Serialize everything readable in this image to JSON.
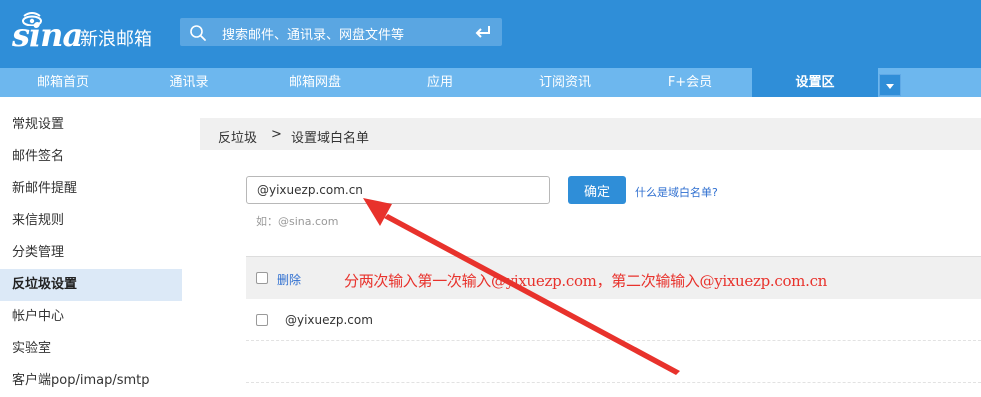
{
  "header": {
    "logo_text": "sina",
    "app_title": "新浪邮箱",
    "search_placeholder": "搜索邮件、通讯录、网盘文件等"
  },
  "nav": {
    "tabs": [
      {
        "label": "邮箱首页"
      },
      {
        "label": "通讯录"
      },
      {
        "label": "邮箱网盘"
      },
      {
        "label": "应用"
      },
      {
        "label": "订阅资讯"
      },
      {
        "label": "F+会员"
      },
      {
        "label": "设置区",
        "active": true
      }
    ]
  },
  "sidebar": {
    "items": [
      {
        "label": "常规设置"
      },
      {
        "label": "邮件签名"
      },
      {
        "label": "新邮件提醒"
      },
      {
        "label": "来信规则"
      },
      {
        "label": "分类管理"
      },
      {
        "label": "反垃圾设置",
        "active": true
      },
      {
        "label": "帐户中心"
      },
      {
        "label": "实验室"
      },
      {
        "label": "客户端pop/imap/smtp"
      }
    ]
  },
  "breadcrumb": {
    "parent": "反垃圾",
    "separator": ">",
    "current": "设置域白名单"
  },
  "form": {
    "domain_value": "@yixuezp.com.cn",
    "hint": "如：@sina.com",
    "confirm_label": "确定",
    "help_link": "什么是域白名单?"
  },
  "list": {
    "delete_label": "删除",
    "rows": [
      "@yixuezp.com"
    ]
  },
  "annotation": {
    "text": "分两次输入第一次输入@yixuezp.com，第二次输输入@yixuezp.com.cn",
    "color": "#e8322c"
  },
  "colors": {
    "header_bg": "#2f8ed8",
    "nav_bg": "#6db7ee",
    "active_tab_bg": "#2f8ed8",
    "sidebar_active_bg": "#dce9f7",
    "link": "#2f6fd0"
  },
  "icons": {
    "logo": "sina-eye-logo",
    "search": "search-icon",
    "enter": "enter-icon",
    "dropdown": "chevron-down-icon"
  }
}
